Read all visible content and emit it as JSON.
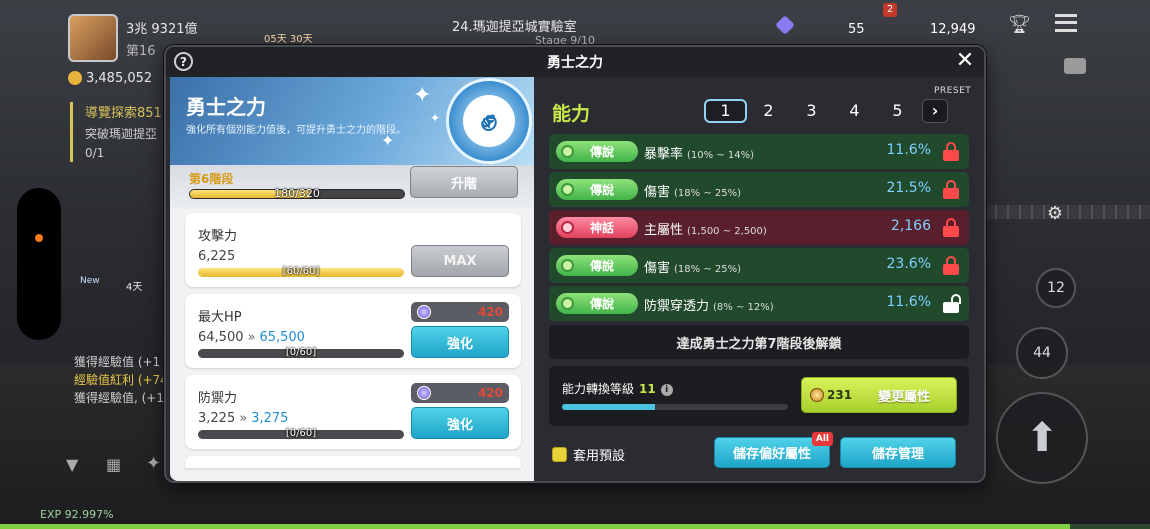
{
  "hud": {
    "power": "3兆 9321億",
    "rank_partial": "第16",
    "mesos": "3,485,052",
    "location": "24.瑪迦提亞城實驗室",
    "stage_partial": "Stage 9/10",
    "event_timer": "05天 30天",
    "gem_count": "55",
    "notif_badge": "2",
    "currency": "12,949",
    "quest_title": "導覽探索851",
    "quest_desc": "突破瑪迦提亞",
    "quest_progress": "0/1",
    "new_label": "New",
    "days_label": "4天",
    "chat_lines": [
      "獲得經驗值 (+1",
      "經驗值紅利 (+74",
      "獲得經驗值, (+1"
    ],
    "exp": "EXP 92.997%",
    "skill_count_a": "12",
    "skill_count_b": "44"
  },
  "modal": {
    "title": "勇士之力",
    "help": "?",
    "close": "✕"
  },
  "left": {
    "hero_title": "勇士之力",
    "hero_desc": "強化所有個別能力值後，可提升勇士之力的階段。",
    "stage_label": "第6階段",
    "stage_count": "180/320",
    "stage_progress": 0.5625,
    "upgrade_label": "升階",
    "stats": [
      {
        "name": "攻擊力",
        "value": "6,225",
        "count": "[60/60]",
        "progress": 1.0,
        "button": "MAX"
      },
      {
        "name": "最大HP",
        "value": "64,500",
        "next": "65,500",
        "count": "[0/60]",
        "progress": 0,
        "cost": "420",
        "button": "強化"
      },
      {
        "name": "防禦力",
        "value": "3,225",
        "next": "3,275",
        "count": "[0/60]",
        "progress": 0,
        "cost": "420",
        "button": "強化"
      }
    ]
  },
  "right": {
    "section_title": "能力",
    "preset_label": "PRESET",
    "preset_tabs": [
      "1",
      "2",
      "3",
      "4",
      "5"
    ],
    "preset_next": "›",
    "abilities": [
      {
        "grade": "傳說",
        "name": "暴擊率",
        "range": "(10% ~ 14%)",
        "value": "11.6%",
        "locked": true
      },
      {
        "grade": "傳說",
        "name": "傷害",
        "range": "(18% ~ 25%)",
        "value": "21.5%",
        "locked": true
      },
      {
        "grade": "神話",
        "name": "主屬性",
        "range": "(1,500 ~ 2,500)",
        "value": "2,166",
        "locked": true
      },
      {
        "grade": "傳說",
        "name": "傷害",
        "range": "(18% ~ 25%)",
        "value": "23.6%",
        "locked": true
      },
      {
        "grade": "傳說",
        "name": "防禦穿透力",
        "range": "(8% ~ 12%)",
        "value": "11.6%",
        "locked": false
      }
    ],
    "unlock_text": "達成勇士之力第7階段後解鎖",
    "convert_label": "能力轉換等級",
    "convert_level": "11",
    "convert_progress": 0.41,
    "change_cost": "231",
    "change_label": "變更屬性",
    "use_preset": "套用預設",
    "save_pref": "儲存偏好屬性",
    "save_pref_badge": "All",
    "save_mgmt": "儲存管理"
  },
  "colors": {
    "legend_grade": "#42b44a",
    "myth_grade": "#e0415e",
    "accent_cyan": "#1fa5c9",
    "title_lime": "#c8e84a",
    "lock_red": "#ff4a4a"
  }
}
